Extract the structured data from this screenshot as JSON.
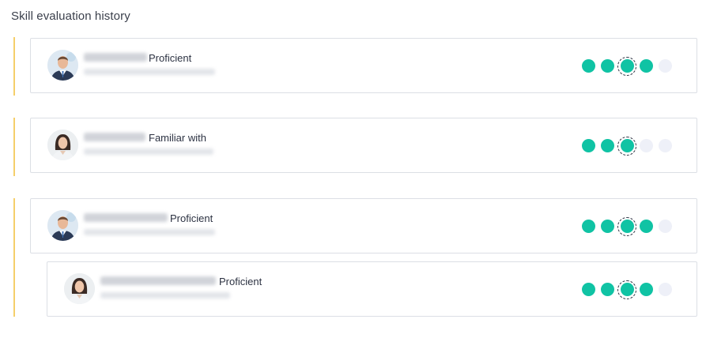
{
  "page": {
    "title": "Skill evaluation history"
  },
  "colors": {
    "accent_bar": "#f5cf6a",
    "dot_filled": "#10c3a4",
    "dot_empty": "#eef0f8",
    "card_border": "#dcdfe5"
  },
  "evaluations": [
    {
      "avatar": "male-avatar",
      "name": "",
      "level": "Proficient",
      "rating": 4,
      "current": 3,
      "max": 5
    },
    {
      "avatar": "female-avatar",
      "name": "",
      "level": "Familiar with",
      "rating": 3,
      "current": 3,
      "max": 5
    },
    {
      "avatar": "male-avatar",
      "name": "",
      "level": "Proficient",
      "rating": 4,
      "current": 3,
      "max": 5
    },
    {
      "avatar": "female-avatar",
      "name": "",
      "level": "Proficient",
      "rating": 4,
      "current": 3,
      "max": 5
    }
  ]
}
